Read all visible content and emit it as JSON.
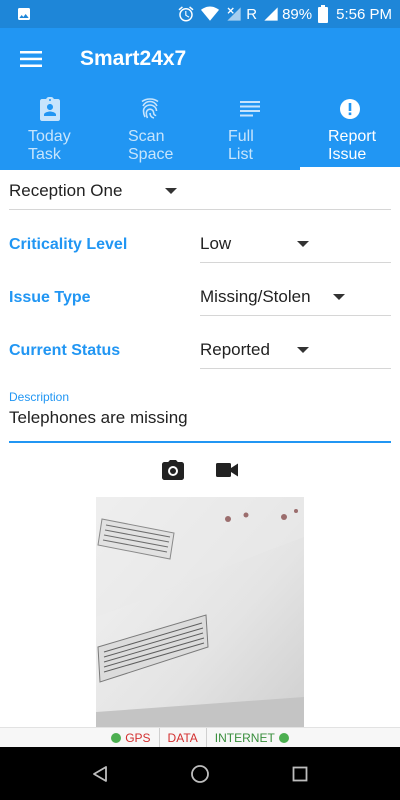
{
  "status_bar": {
    "battery_percent": "89%",
    "time": "5:56 PM",
    "network_label": "R",
    "icons": [
      "image-icon",
      "alarm-icon",
      "wifi-icon",
      "signal-off-icon",
      "signal-icon",
      "battery-icon"
    ]
  },
  "app_bar": {
    "title": "Smart24x7",
    "menu_icon": "hamburger-menu-icon"
  },
  "tabs": [
    {
      "label": "Today Task",
      "icon": "clipboard-user-icon",
      "active": false
    },
    {
      "label": "Scan Space",
      "icon": "fingerprint-icon",
      "active": false
    },
    {
      "label": "Full List",
      "icon": "list-icon",
      "active": false
    },
    {
      "label": "Report Issue",
      "icon": "alert-circle-icon",
      "active": true
    }
  ],
  "form": {
    "location_value": "Reception One",
    "criticality": {
      "label": "Criticality Level",
      "value": "Low"
    },
    "issue_type": {
      "label": "Issue Type",
      "value": "Missing/Stolen"
    },
    "current_status": {
      "label": "Current Status",
      "value": "Reported"
    },
    "description": {
      "label": "Description",
      "value": "Telephones are missing"
    }
  },
  "media": {
    "camera_icon": "camera-icon",
    "video_icon": "videocam-icon"
  },
  "indicators": [
    {
      "label": "GPS",
      "color": "#d32f2f",
      "dot_left": true,
      "dot_right": false
    },
    {
      "label": "DATA",
      "color": "#d32f2f",
      "dot_left": false,
      "dot_right": false
    },
    {
      "label": "INTERNET",
      "color": "#388e3c",
      "dot_left": false,
      "dot_right": true
    }
  ],
  "colors": {
    "primary": "#2196f3",
    "status_bar": "#1e86d8",
    "indicator_dot": "#4caf50"
  }
}
